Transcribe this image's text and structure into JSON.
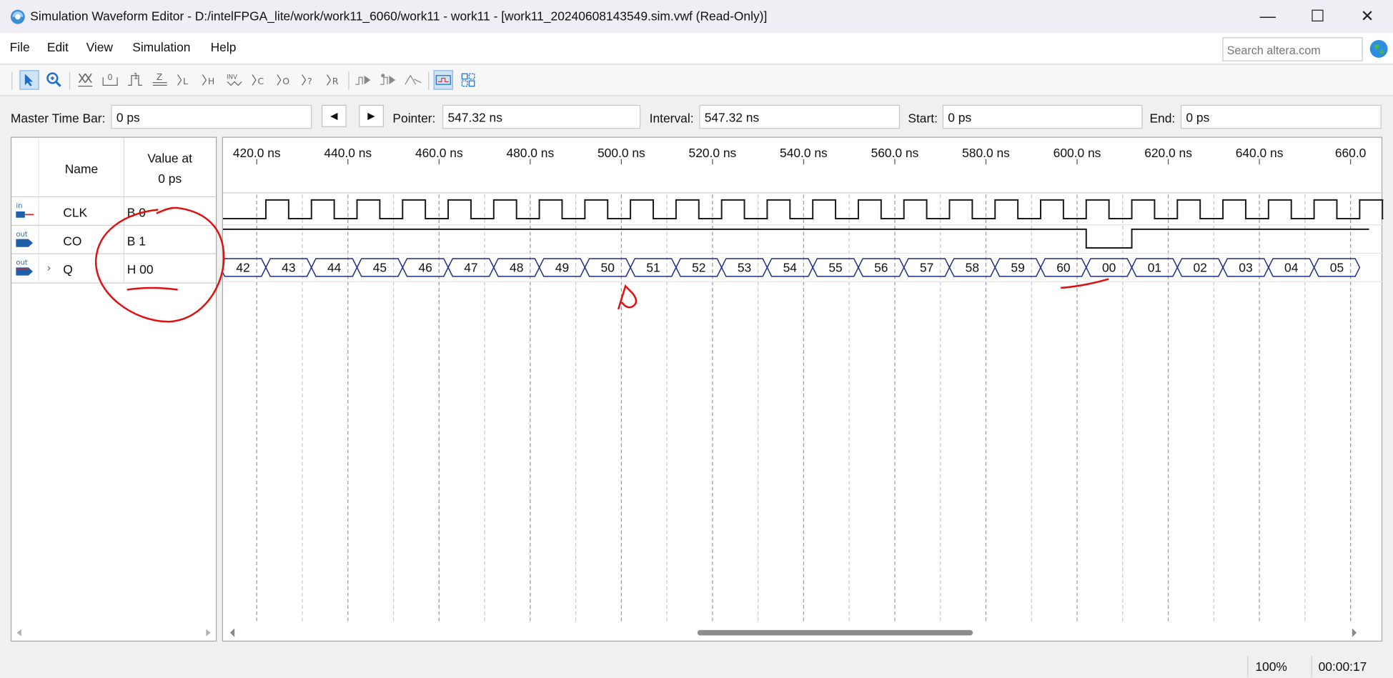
{
  "window": {
    "title": "Simulation Waveform Editor - D:/intelFPGA_lite/work/work11_6060/work11 - work11 - [work11_20240608143549.sim.vwf (Read-Only)]",
    "minimize_glyph": "—",
    "maximize_glyph": "☐",
    "close_glyph": "✕"
  },
  "menu": {
    "items": [
      "File",
      "Edit",
      "View",
      "Simulation",
      "Help"
    ]
  },
  "search": {
    "placeholder": "Search altera.com"
  },
  "toolbar": {
    "icons": [
      {
        "name": "selection-tool-icon",
        "glyph": "➤"
      },
      {
        "name": "zoom-tool-icon",
        "glyph": "⊕"
      },
      {
        "name": "force-unknown-icon",
        "glyph": "XXX"
      },
      {
        "name": "force-low-icon",
        "glyph": "0"
      },
      {
        "name": "force-high-icon",
        "glyph": "1"
      },
      {
        "name": "force-high-impedance-icon",
        "glyph": "Z"
      },
      {
        "name": "force-weak-low-icon",
        "glyph": "L"
      },
      {
        "name": "force-weak-high-icon",
        "glyph": "H"
      },
      {
        "name": "invert-icon",
        "glyph": "INV"
      },
      {
        "name": "count-value-icon",
        "glyph": "C"
      },
      {
        "name": "overwrite-clock-icon",
        "glyph": "O"
      },
      {
        "name": "arbitrary-value-icon",
        "glyph": "?"
      },
      {
        "name": "random-values-icon",
        "glyph": "R"
      },
      {
        "name": "run-functional-simulation-icon",
        "glyph": "⇉"
      },
      {
        "name": "run-timing-simulation-icon",
        "glyph": "⇉"
      },
      {
        "name": "generate-netlist-icon",
        "glyph": "⇶"
      },
      {
        "name": "waveform-compare-icon",
        "glyph": "▤"
      },
      {
        "name": "snap-to-grid-icon",
        "glyph": "▦"
      }
    ]
  },
  "timebar": {
    "master_label": "Master Time Bar:",
    "master_value": "0 ps",
    "prev_glyph": "◀",
    "next_glyph": "▶",
    "pointer_label": "Pointer:",
    "pointer_value": "547.32 ns",
    "interval_label": "Interval:",
    "interval_value": "547.32 ns",
    "start_label": "Start:",
    "start_value": "0 ps",
    "end_label": "End:",
    "end_value": "0 ps"
  },
  "signal_table": {
    "header_name": "Name",
    "header_value_line1": "Value at",
    "header_value_line2": "0 ps",
    "rows": [
      {
        "name": "CLK",
        "value": "B 0",
        "direction": "in"
      },
      {
        "name": "CO",
        "value": "B 1",
        "direction": "out"
      },
      {
        "name": "Q",
        "value": "H 00",
        "direction": "out",
        "expandable": true
      }
    ],
    "pin_in_label": "in",
    "pin_out_label": "out",
    "expand_glyph": "›"
  },
  "waveform": {
    "time_labels": [
      "420.0 ns",
      "440.0 ns",
      "460.0 ns",
      "480.0 ns",
      "500.0 ns",
      "520.0 ns",
      "540.0 ns",
      "560.0 ns",
      "580.0 ns",
      "600.0 ns",
      "620.0 ns",
      "640.0 ns",
      "660.0"
    ],
    "time_start_ns": 420,
    "time_step_ns": 20,
    "clk_period_ns": 10,
    "clk_first_rise_ns": 422,
    "co_low_start_ns": 602,
    "co_low_end_ns": 612,
    "q_values": [
      "42",
      "43",
      "44",
      "45",
      "46",
      "47",
      "48",
      "49",
      "50",
      "51",
      "52",
      "53",
      "54",
      "55",
      "56",
      "57",
      "58",
      "59",
      "60",
      "00",
      "01",
      "02",
      "03",
      "04",
      "05"
    ],
    "q_first_transition_ns": 422,
    "colors": {
      "signal": "#1a1a1a",
      "bus": "#1f2f8a",
      "grid": "#9a9a9a",
      "annotation": "#e01010"
    }
  },
  "status": {
    "zoom": "100%",
    "elapsed": "00:00:17"
  }
}
